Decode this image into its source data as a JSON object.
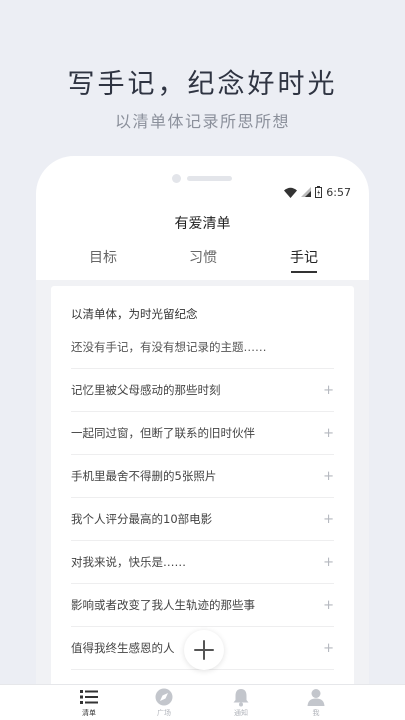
{
  "promo": {
    "headline": "写手记，纪念好时光",
    "subline": "以清单体记录所思所想"
  },
  "status_bar": {
    "time": "6:57"
  },
  "app": {
    "title": "有爱清单"
  },
  "tabs": [
    {
      "label": "目标",
      "active": false
    },
    {
      "label": "习惯",
      "active": false
    },
    {
      "label": "手记",
      "active": true
    }
  ],
  "card": {
    "header": "以清单体，为时光留纪念",
    "placeholder": "还没有手记，有没有想记录的主题……",
    "items": [
      "记忆里被父母感动的那些时刻",
      "一起同过窗，但断了联系的旧时伙伴",
      "手机里最舍不得删的5张照片",
      "我个人评分最高的10部电影",
      "对我来说，快乐是……",
      "影响或者改变了我人生轨迹的那些事",
      "值得我终生感恩的人"
    ]
  },
  "bottom_nav": [
    {
      "label": "清单",
      "icon": "list-icon",
      "active": true
    },
    {
      "label": "广场",
      "icon": "compass-icon",
      "active": false
    },
    {
      "label": "通知",
      "icon": "bell-icon",
      "active": false
    },
    {
      "label": "我",
      "icon": "user-icon",
      "active": false
    }
  ],
  "colors": {
    "background": "#eceef4",
    "headline": "#2f3442",
    "accent": "#333333"
  }
}
